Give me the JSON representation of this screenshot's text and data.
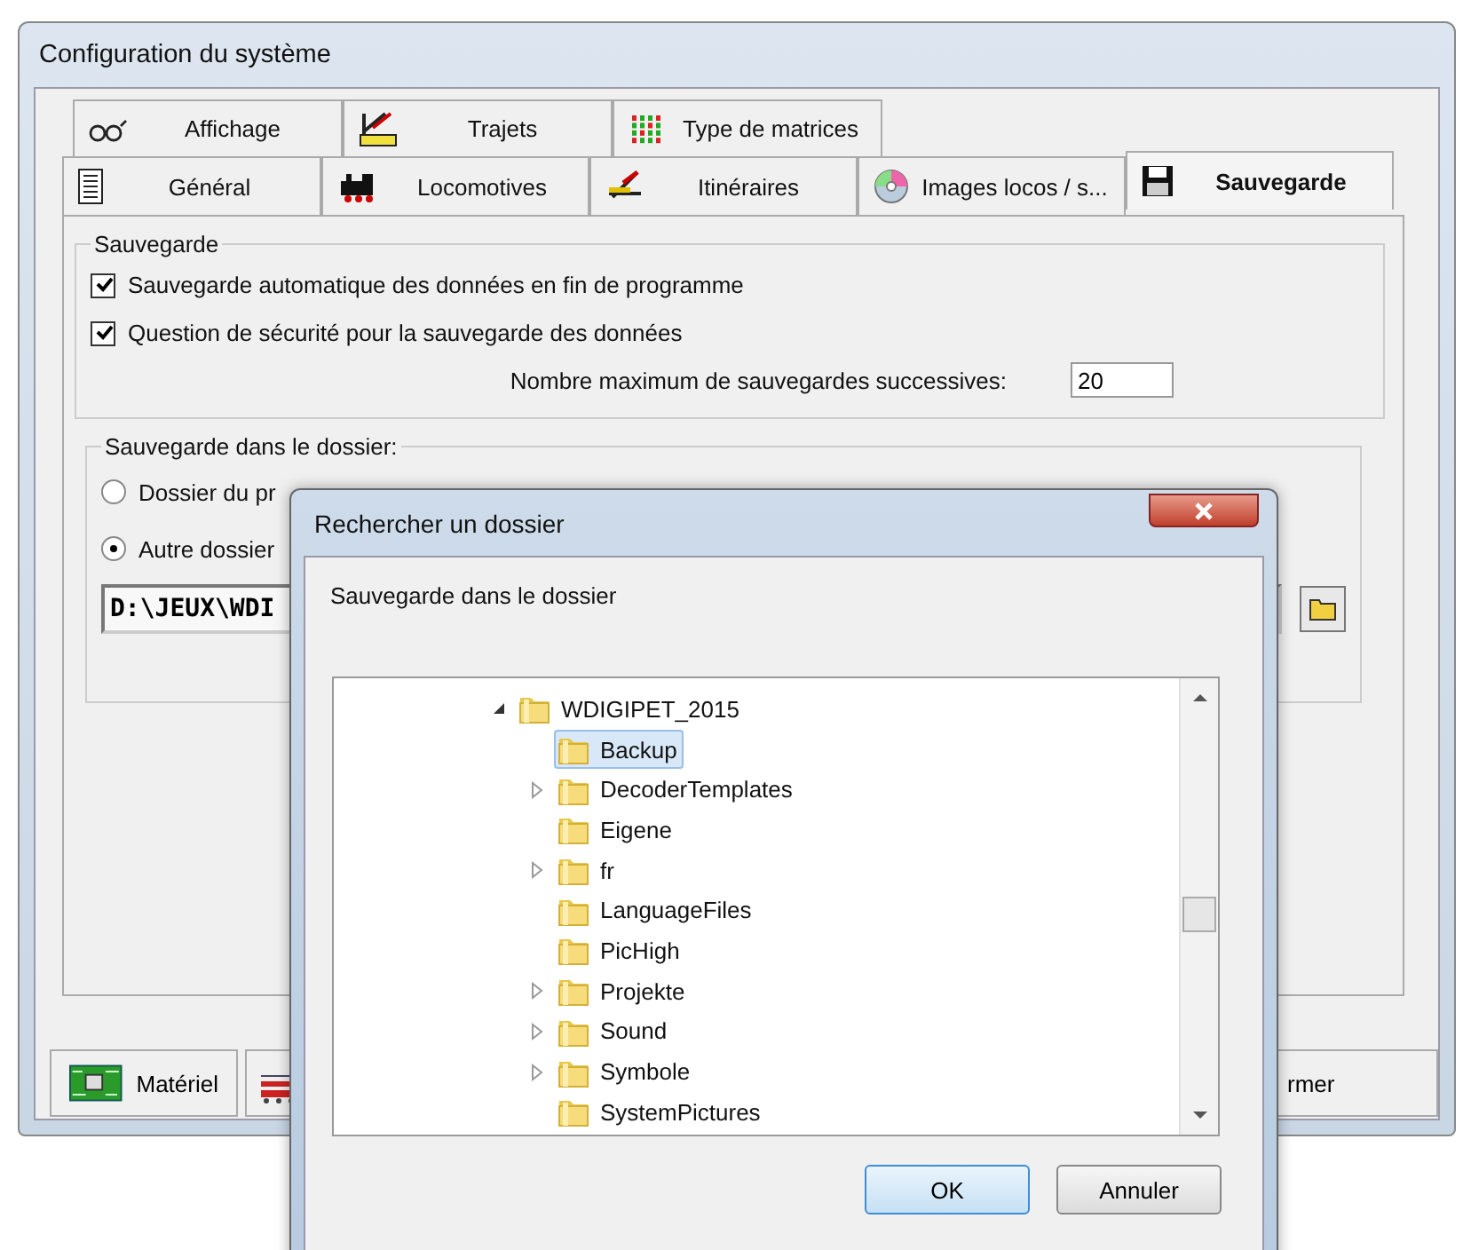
{
  "window": {
    "title": "Configuration du système"
  },
  "tab_rows": [
    [
      {
        "label": "Affichage",
        "selected": false
      },
      {
        "label": "Trajets",
        "selected": false
      },
      {
        "label": "Type de matrices",
        "selected": false
      }
    ],
    [
      {
        "label": "Général",
        "selected": false
      },
      {
        "label": "Locomotives",
        "selected": false
      },
      {
        "label": "Itinéraires",
        "selected": false
      },
      {
        "label": "Images locos / s...",
        "selected": false
      },
      {
        "label": "Sauvegarde",
        "selected": true
      }
    ]
  ],
  "backup_group": {
    "title": "Sauvegarde",
    "checkboxes": [
      {
        "label": "Sauvegarde automatique des données en fin de programme",
        "checked": true
      },
      {
        "label": "Question de sécurité pour la sauvegarde des données",
        "checked": true
      }
    ],
    "max_backups": {
      "label": "Nombre maximum de sauvegardes successives:",
      "value": "20"
    }
  },
  "folder_group": {
    "title": "Sauvegarde dans le dossier:",
    "radios": [
      {
        "label": "Dossier du pr",
        "selected": false
      },
      {
        "label": "Autre dossier",
        "selected": true
      }
    ],
    "path": {
      "value": "D:\\JEUX\\WDI"
    }
  },
  "bottom_buttons": [
    {
      "label": "Matériel"
    },
    {
      "label": "rmer"
    }
  ],
  "dialog": {
    "title": "Rechercher un dossier",
    "prompt": "Sauvegarde dans le dossier",
    "tree": [
      {
        "label": "WDIGIPET_2015",
        "expanded": true,
        "selected": false,
        "children": [
          {
            "label": "Backup",
            "expandable": false,
            "selected": true
          },
          {
            "label": "DecoderTemplates",
            "expandable": true,
            "selected": false
          },
          {
            "label": "Eigene",
            "expandable": false,
            "selected": false
          },
          {
            "label": "fr",
            "expandable": true,
            "selected": false
          },
          {
            "label": "LanguageFiles",
            "expandable": false,
            "selected": false
          },
          {
            "label": "PicHigh",
            "expandable": false,
            "selected": false
          },
          {
            "label": "Projekte",
            "expandable": true,
            "selected": false
          },
          {
            "label": "Sound",
            "expandable": true,
            "selected": false
          },
          {
            "label": "Symbole",
            "expandable": true,
            "selected": false
          },
          {
            "label": "SystemPictures",
            "expandable": false,
            "selected": false
          }
        ]
      }
    ],
    "buttons": [
      {
        "label": "OK",
        "default": true
      },
      {
        "label": "Annuler",
        "default": false
      }
    ]
  }
}
